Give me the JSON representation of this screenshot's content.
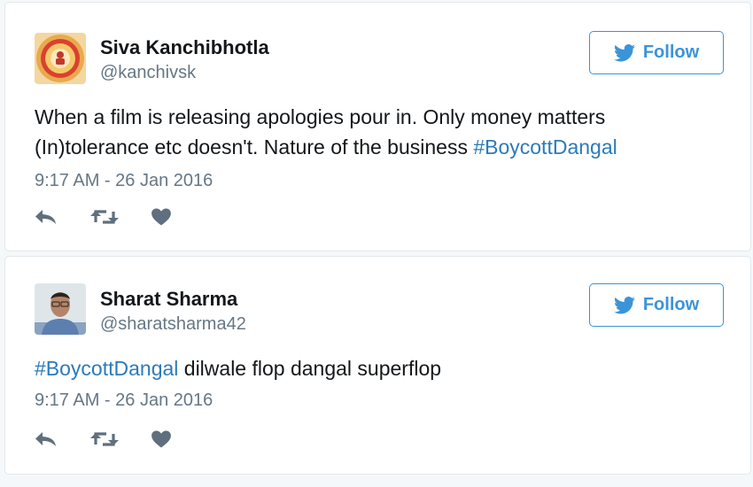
{
  "tweets": [
    {
      "author_name": "Siva Kanchibhotla",
      "handle": "@kanchivsk",
      "follow_label": "Follow",
      "text_line1": "When a film is releasing apologies pour in. Only money matters",
      "text_line2_plain": "(In)tolerance etc doesn't. Nature of the business ",
      "hashtag": "#BoycottDangal",
      "timestamp": "9:17 AM - 26 Jan 2016"
    },
    {
      "author_name": "Sharat Sharma",
      "handle": "@sharatsharma42",
      "follow_label": "Follow",
      "hashtag": "#BoycottDangal",
      "text_rest": " dilwale flop dangal superflop",
      "timestamp": "9:17 AM - 26 Jan 2016"
    }
  ],
  "icons": {
    "follow": "twitter-bird-icon",
    "reply": "reply-icon",
    "retweet": "retweet-icon",
    "like": "heart-icon"
  },
  "colors": {
    "accent": "#3b94d9",
    "hashtag": "#2b7bb9",
    "muted": "#657786",
    "action_icon": "#5f6f7d"
  }
}
